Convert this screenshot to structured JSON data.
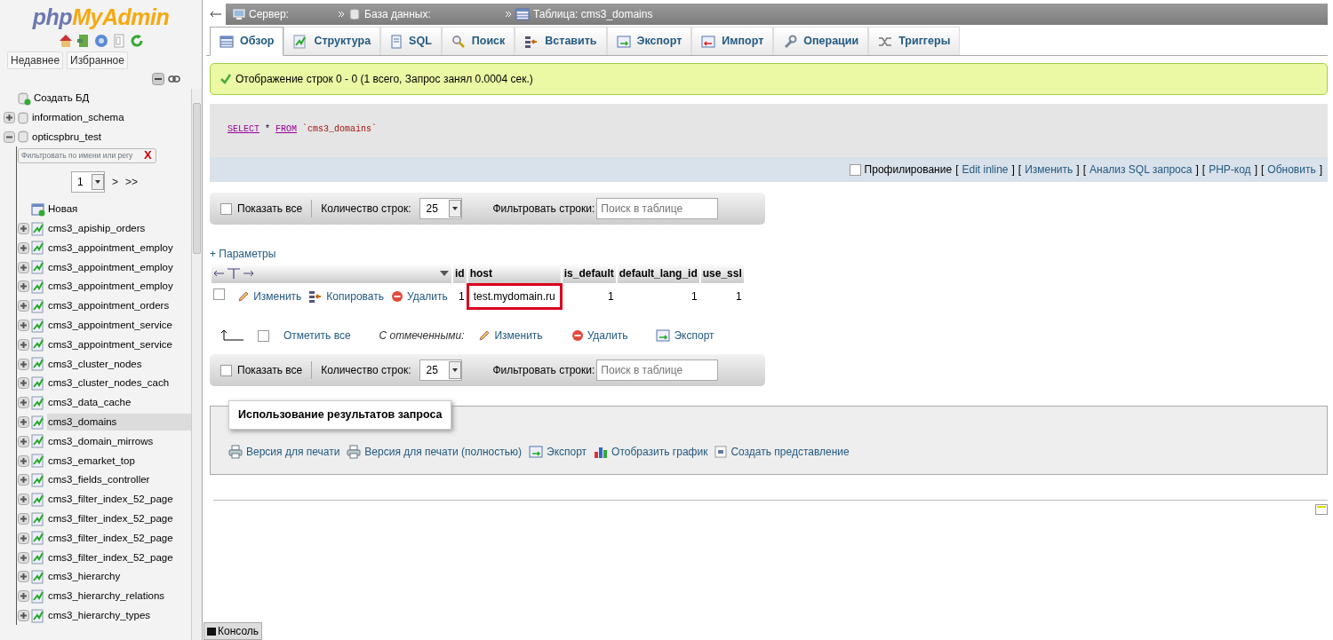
{
  "sidebar": {
    "logo": {
      "part_1": "php",
      "part_2": "MyAdmin"
    },
    "tabs": [
      "Недавнее",
      "Избранное"
    ],
    "tree": [
      {
        "kind": "create",
        "label": "Создать БД",
        "selected": false
      },
      {
        "kind": "db",
        "label": "information_schema",
        "expanded": false,
        "selected": false
      },
      {
        "kind": "db",
        "label": "opticspbru_test",
        "expanded": true,
        "selected": false,
        "filter": {
          "placeholder": "Фильтровать по имени или регу",
          "clear": "X"
        },
        "pager": {
          "page": "1",
          "next": ">",
          "last": ">>"
        },
        "children": [
          {
            "kind": "new",
            "label": "Новая",
            "selected": false
          },
          {
            "kind": "table",
            "label": "cms3_apiship_orders",
            "expanded": false,
            "selected": false
          },
          {
            "kind": "table",
            "label": "cms3_appointment_employ",
            "expanded": false,
            "selected": false
          },
          {
            "kind": "table",
            "label": "cms3_appointment_employ",
            "expanded": false,
            "selected": false
          },
          {
            "kind": "table",
            "label": "cms3_appointment_employ",
            "expanded": false,
            "selected": false
          },
          {
            "kind": "table",
            "label": "cms3_appointment_orders",
            "expanded": false,
            "selected": false
          },
          {
            "kind": "table",
            "label": "cms3_appointment_service",
            "expanded": false,
            "selected": false
          },
          {
            "kind": "table",
            "label": "cms3_appointment_service",
            "expanded": false,
            "selected": false
          },
          {
            "kind": "table",
            "label": "cms3_cluster_nodes",
            "expanded": false,
            "selected": false
          },
          {
            "kind": "table",
            "label": "cms3_cluster_nodes_cach",
            "expanded": false,
            "selected": false
          },
          {
            "kind": "table",
            "label": "cms3_data_cache",
            "expanded": false,
            "selected": false
          },
          {
            "kind": "table",
            "label": "cms3_domains",
            "expanded": false,
            "selected": true
          },
          {
            "kind": "table",
            "label": "cms3_domain_mirrows",
            "expanded": false,
            "selected": false
          },
          {
            "kind": "table",
            "label": "cms3_emarket_top",
            "expanded": false,
            "selected": false
          },
          {
            "kind": "table",
            "label": "cms3_fields_controller",
            "expanded": false,
            "selected": false
          },
          {
            "kind": "table",
            "label": "cms3_filter_index_52_page",
            "expanded": false,
            "selected": false
          },
          {
            "kind": "table",
            "label": "cms3_filter_index_52_page",
            "expanded": false,
            "selected": false
          },
          {
            "kind": "table",
            "label": "cms3_filter_index_52_page",
            "expanded": false,
            "selected": false
          },
          {
            "kind": "table",
            "label": "cms3_filter_index_52_page",
            "expanded": false,
            "selected": false
          },
          {
            "kind": "table",
            "label": "cms3_hierarchy",
            "expanded": false,
            "selected": false
          },
          {
            "kind": "table",
            "label": "cms3_hierarchy_relations",
            "expanded": false,
            "selected": false
          },
          {
            "kind": "table",
            "label": "cms3_hierarchy_types",
            "expanded": false,
            "selected": false
          }
        ]
      }
    ]
  },
  "breadcrumb": [
    "Сервер:",
    "База данных:",
    "Таблица: cms3_domains"
  ],
  "tabs": [
    {
      "label": "Обзор",
      "selected": true
    },
    {
      "label": "Структура",
      "selected": false
    },
    {
      "label": "SQL",
      "selected": false
    },
    {
      "label": "Поиск",
      "selected": false
    },
    {
      "label": "Вставить",
      "selected": false
    },
    {
      "label": "Экспорт",
      "selected": false
    },
    {
      "label": "Импорт",
      "selected": false
    },
    {
      "label": "Операции",
      "selected": false
    },
    {
      "label": "Триггеры",
      "selected": false
    }
  ],
  "message": "Отображение строк 0 - 0 (1 всего, Запрос занял 0.0004 сек.)",
  "query": [
    {
      "kind": "keyword",
      "text": "SELECT"
    },
    {
      "kind": "operator",
      "text": "*"
    },
    {
      "kind": "keyword",
      "text": "FROM"
    },
    {
      "kind": "identifier",
      "text": "`cms3_domains`"
    }
  ],
  "profiling": {
    "label": "Профилирование",
    "checked": false,
    "bracket_open": "[",
    "bracket_close": "]",
    "links": [
      "Edit inline",
      "Изменить",
      "Анализ SQL запроса",
      "PHP-код",
      "Обновить"
    ]
  },
  "nav_bars": [
    {
      "show_all": "Показать все",
      "checked": false,
      "rows_label": "Количество строк:",
      "rows": "25",
      "filter_label": "Фильтровать строки:",
      "placeholder": "Поиск в таблице"
    },
    {
      "show_all": "Показать все",
      "checked": false,
      "rows_label": "Количество строк:",
      "rows": "25",
      "filter_label": "Фильтровать строки:",
      "placeholder": "Поиск в таблице"
    }
  ],
  "options_link": "+ Параметры",
  "table": {
    "columns": [
      "id",
      "host",
      "is_default",
      "default_lang_id",
      "use_ssl"
    ],
    "rows": [
      {
        "checked": false,
        "actions": [
          "Изменить",
          "Копировать",
          "Удалить"
        ],
        "cells": [
          {
            "text": "1",
            "highlighted": false
          },
          {
            "text": "test.mydomain.ru",
            "highlighted": true
          },
          {
            "text": "1",
            "highlighted": false
          },
          {
            "text": "1",
            "highlighted": false
          },
          {
            "text": "1",
            "highlighted": false
          }
        ]
      }
    ]
  },
  "bulk": {
    "mark_all": "Отметить все",
    "checked": false,
    "with_selected": "С отмеченными:",
    "actions": [
      "Изменить",
      "Удалить",
      "Экспорт"
    ]
  },
  "query_results": {
    "legend": "Использование результатов запроса",
    "links": [
      "Версия для печати",
      "Версия для печати (полностью)",
      "Экспорт",
      "Отобразить график",
      "Создать представление"
    ]
  },
  "console": "Консоль"
}
